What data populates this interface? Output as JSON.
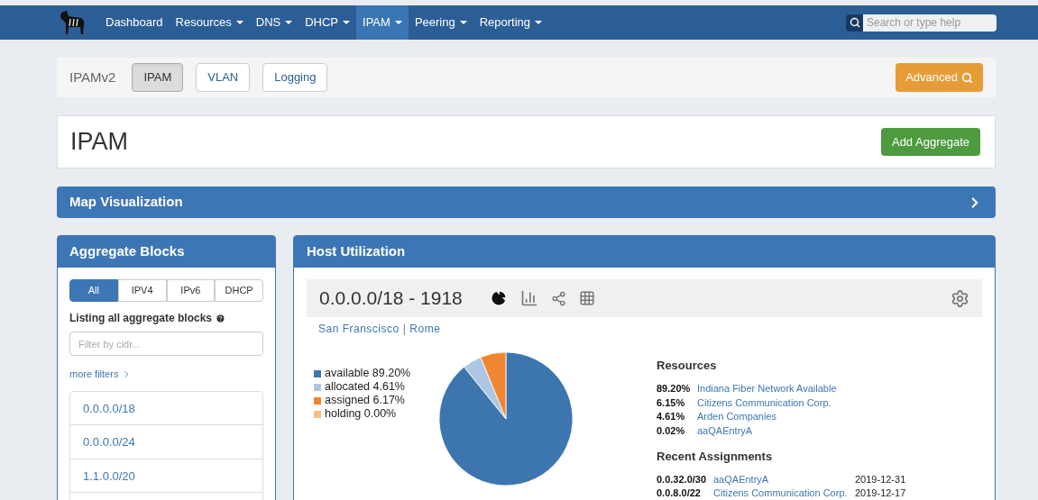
{
  "navbar": {
    "items": [
      {
        "label": "Dashboard",
        "dropdown": false,
        "selected": false
      },
      {
        "label": "Resources",
        "dropdown": true,
        "selected": false
      },
      {
        "label": "DNS",
        "dropdown": true,
        "selected": false
      },
      {
        "label": "DHCP",
        "dropdown": true,
        "selected": false
      },
      {
        "label": "IPAM",
        "dropdown": true,
        "selected": true
      },
      {
        "label": "Peering",
        "dropdown": true,
        "selected": false
      },
      {
        "label": "Reporting",
        "dropdown": true,
        "selected": false
      }
    ],
    "search": {
      "placeholder": "Search or type help"
    }
  },
  "subnav": {
    "title": "IPAMv2",
    "buttons": [
      {
        "label": "IPAM",
        "selected": true
      },
      {
        "label": "VLAN",
        "selected": false
      },
      {
        "label": "Logging",
        "selected": false
      }
    ],
    "advanced": "Advanced"
  },
  "page_header": {
    "title": "IPAM",
    "button": "Add Aggregate"
  },
  "map_panel": {
    "title": "Map Visualization"
  },
  "aggregate_blocks": {
    "title": "Aggregate Blocks",
    "tabs": [
      {
        "label": "All",
        "selected": true
      },
      {
        "label": "IPV4",
        "selected": false
      },
      {
        "label": "IPv6",
        "selected": false
      },
      {
        "label": "DHCP",
        "selected": false
      }
    ],
    "listing": "Listing all aggregate blocks",
    "filter_placeholder": "Filter by cidr...",
    "more_filters": "more filters",
    "blocks": [
      "0.0.0.0/18",
      "0.0.0.0/24",
      "1.1.0.0/20"
    ]
  },
  "host_utilization": {
    "title": "Host Utilization",
    "block_title": "0.0.0.0/18 - 1918",
    "locations": [
      "San Franscisco",
      "Rome"
    ],
    "location_separator": "|",
    "chart_data": {
      "type": "pie",
      "categories": [
        "available 89.20%",
        "allocated 4.61%",
        "assigned 6.17%",
        "holding 0.00%"
      ],
      "values": [
        89.2,
        4.61,
        6.17,
        0.0
      ],
      "colors": [
        "#3d76af",
        "#adc6e5",
        "#ee8632",
        "#f6be82"
      ]
    },
    "resources_title": "Resources",
    "resources": [
      {
        "percent": "89.20%",
        "name": "Indiana Fiber Network Available"
      },
      {
        "percent": "6.15%",
        "name": "Citizens Communication Corp."
      },
      {
        "percent": "4.61%",
        "name": "Arden Companies"
      },
      {
        "percent": "0.02%",
        "name": "aaQAEntryA"
      }
    ],
    "recent_title": "Recent Assignments",
    "recent": [
      {
        "cidr": "0.0.32.0/30",
        "name": "aaQAEntryA",
        "date": "2019-12-31"
      },
      {
        "cidr": "0.0.8.0/22",
        "name": "Citizens Communication Corp.",
        "date": "2019-12-17"
      }
    ]
  }
}
